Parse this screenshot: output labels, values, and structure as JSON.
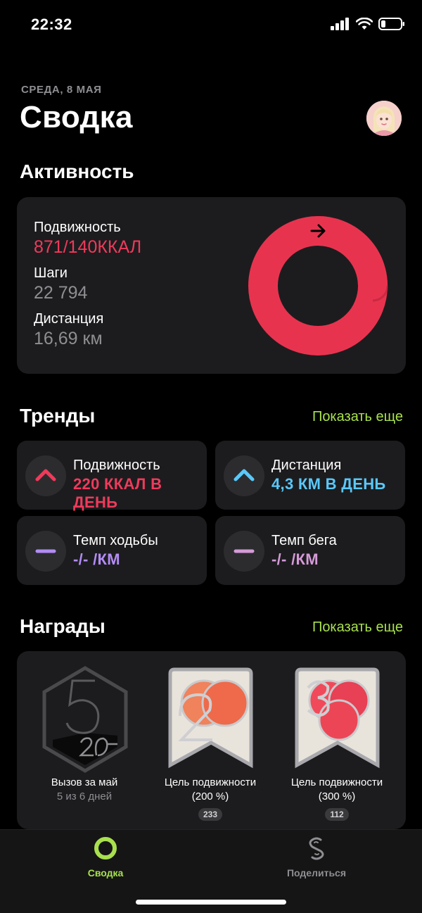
{
  "status": {
    "time": "22:32"
  },
  "header": {
    "date": "СРЕДА, 8 МАЯ",
    "title": "Сводка"
  },
  "activity": {
    "section_title": "Активность",
    "move_label": "Подвижность",
    "move_value": "871/140ККАЛ",
    "steps_label": "Шаги",
    "steps_value": "22 794",
    "distance_label": "Дистанция",
    "distance_value": "16,69 км",
    "ring_progress": 6.22,
    "ring_color": "#e8334f"
  },
  "trends": {
    "section_title": "Тренды",
    "show_more": "Показать еще",
    "items": [
      {
        "label": "Подвижность",
        "value": "220 ККАЛ В ДЕНЬ",
        "color": "#f03a5b",
        "icon": "chevron-up-icon"
      },
      {
        "label": "Дистанция",
        "value": "4,3 КМ В ДЕНЬ",
        "color": "#5ac8fa",
        "icon": "chevron-up-icon"
      },
      {
        "label": "Темп ходьбы",
        "value": "-/- /КМ",
        "color": "#b38cf5",
        "icon": "dash-icon"
      },
      {
        "label": "Темп бега",
        "value": "-/- /КМ",
        "color": "#d59ad8",
        "icon": "dash-icon"
      }
    ]
  },
  "awards": {
    "section_title": "Награды",
    "show_more": "Показать еще",
    "items": [
      {
        "name": "Вызов за май",
        "sub": "5 из 6 дней",
        "count": null
      },
      {
        "name": "Цель подвижности",
        "sub": "(200 %)",
        "count": "233"
      },
      {
        "name": "Цель подвижности",
        "sub": "(300 %)",
        "count": "112"
      }
    ]
  },
  "tabbar": {
    "summary_label": "Сводка",
    "share_label": "Поделиться",
    "accent": "#a8e04e"
  }
}
